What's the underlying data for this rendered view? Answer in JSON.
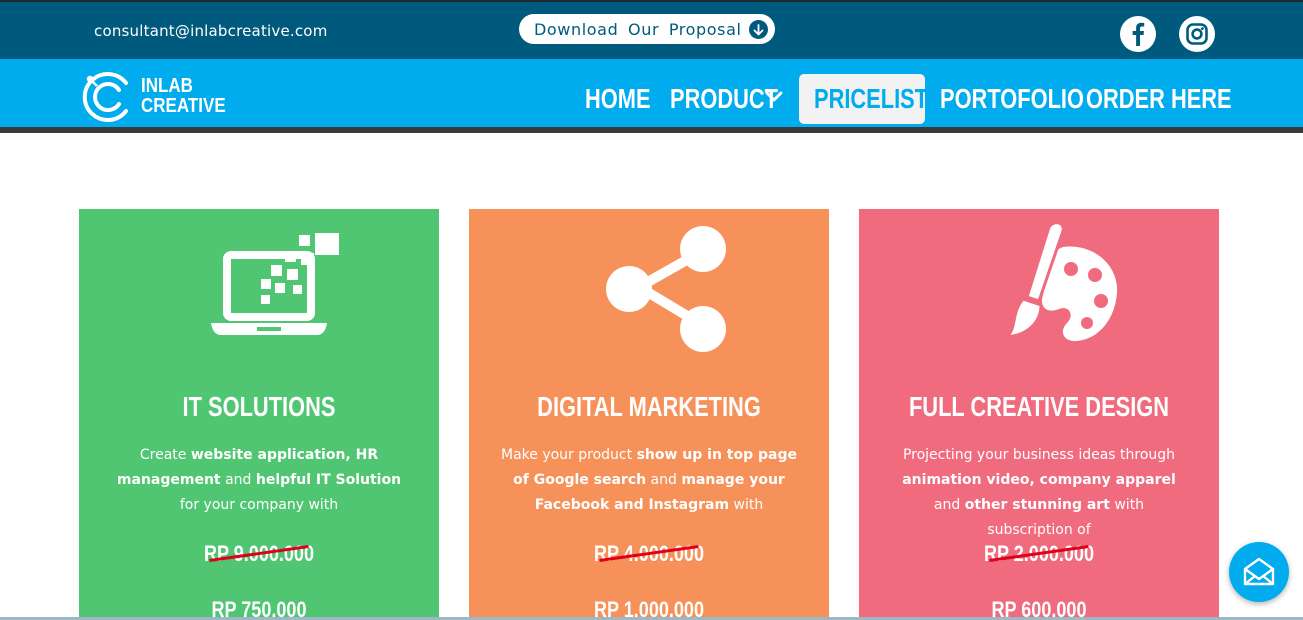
{
  "topbar": {
    "email": "consultant@inlabcreative.com",
    "proposal_label": "Download Our Proposal",
    "proposal_icon": "download-circle-icon",
    "social": [
      "facebook-icon",
      "instagram-icon"
    ]
  },
  "navbar": {
    "logo_line1": "INLAB",
    "logo_line2": "CREATIVE",
    "items": [
      {
        "label": "HOME"
      },
      {
        "label": "PRODUCT"
      },
      {
        "label": "PRICELIST"
      },
      {
        "label": "PORTOFOLIO"
      },
      {
        "label": "ORDER HERE"
      }
    ],
    "active": "PRICELIST"
  },
  "cards": [
    {
      "title": "IT SOLUTIONS",
      "icon": "laptop-pixels-icon",
      "desc": [
        {
          "t": "Create ",
          "b": false
        },
        {
          "t": "website application, HR management",
          "b": true
        },
        {
          "t": " and ",
          "b": false
        },
        {
          "t": "helpful IT Solution",
          "b": true
        },
        {
          "t": " for your company with",
          "b": false
        }
      ],
      "old_price": "RP 9.000.000",
      "new_price": "RP 750.000",
      "color": "#50c672"
    },
    {
      "title": "DIGITAL MARKETING",
      "icon": "share-icon",
      "desc": [
        {
          "t": "Make your product ",
          "b": false
        },
        {
          "t": "show up in top page of Google search",
          "b": true
        },
        {
          "t": " and ",
          "b": false
        },
        {
          "t": "manage your Facebook and Instagram",
          "b": true
        },
        {
          "t": " with",
          "b": false
        }
      ],
      "old_price": "RP 4.000.000",
      "new_price": "RP 1.000.000",
      "color": "#f6915a"
    },
    {
      "title": "FULL CREATIVE DESIGN",
      "icon": "palette-brush-icon",
      "desc": [
        {
          "t": "Projecting your business ideas through ",
          "b": false
        },
        {
          "t": "animation video, company apparel",
          "b": true
        },
        {
          "t": " and ",
          "b": false
        },
        {
          "t": "other stunning art",
          "b": true
        },
        {
          "t": " with subscription of",
          "b": false
        }
      ],
      "old_price": "RP 2.000.000",
      "new_price": "RP 600.000",
      "color": "#f06b7e"
    }
  ],
  "chat": {
    "icon": "envelope-open-icon"
  }
}
